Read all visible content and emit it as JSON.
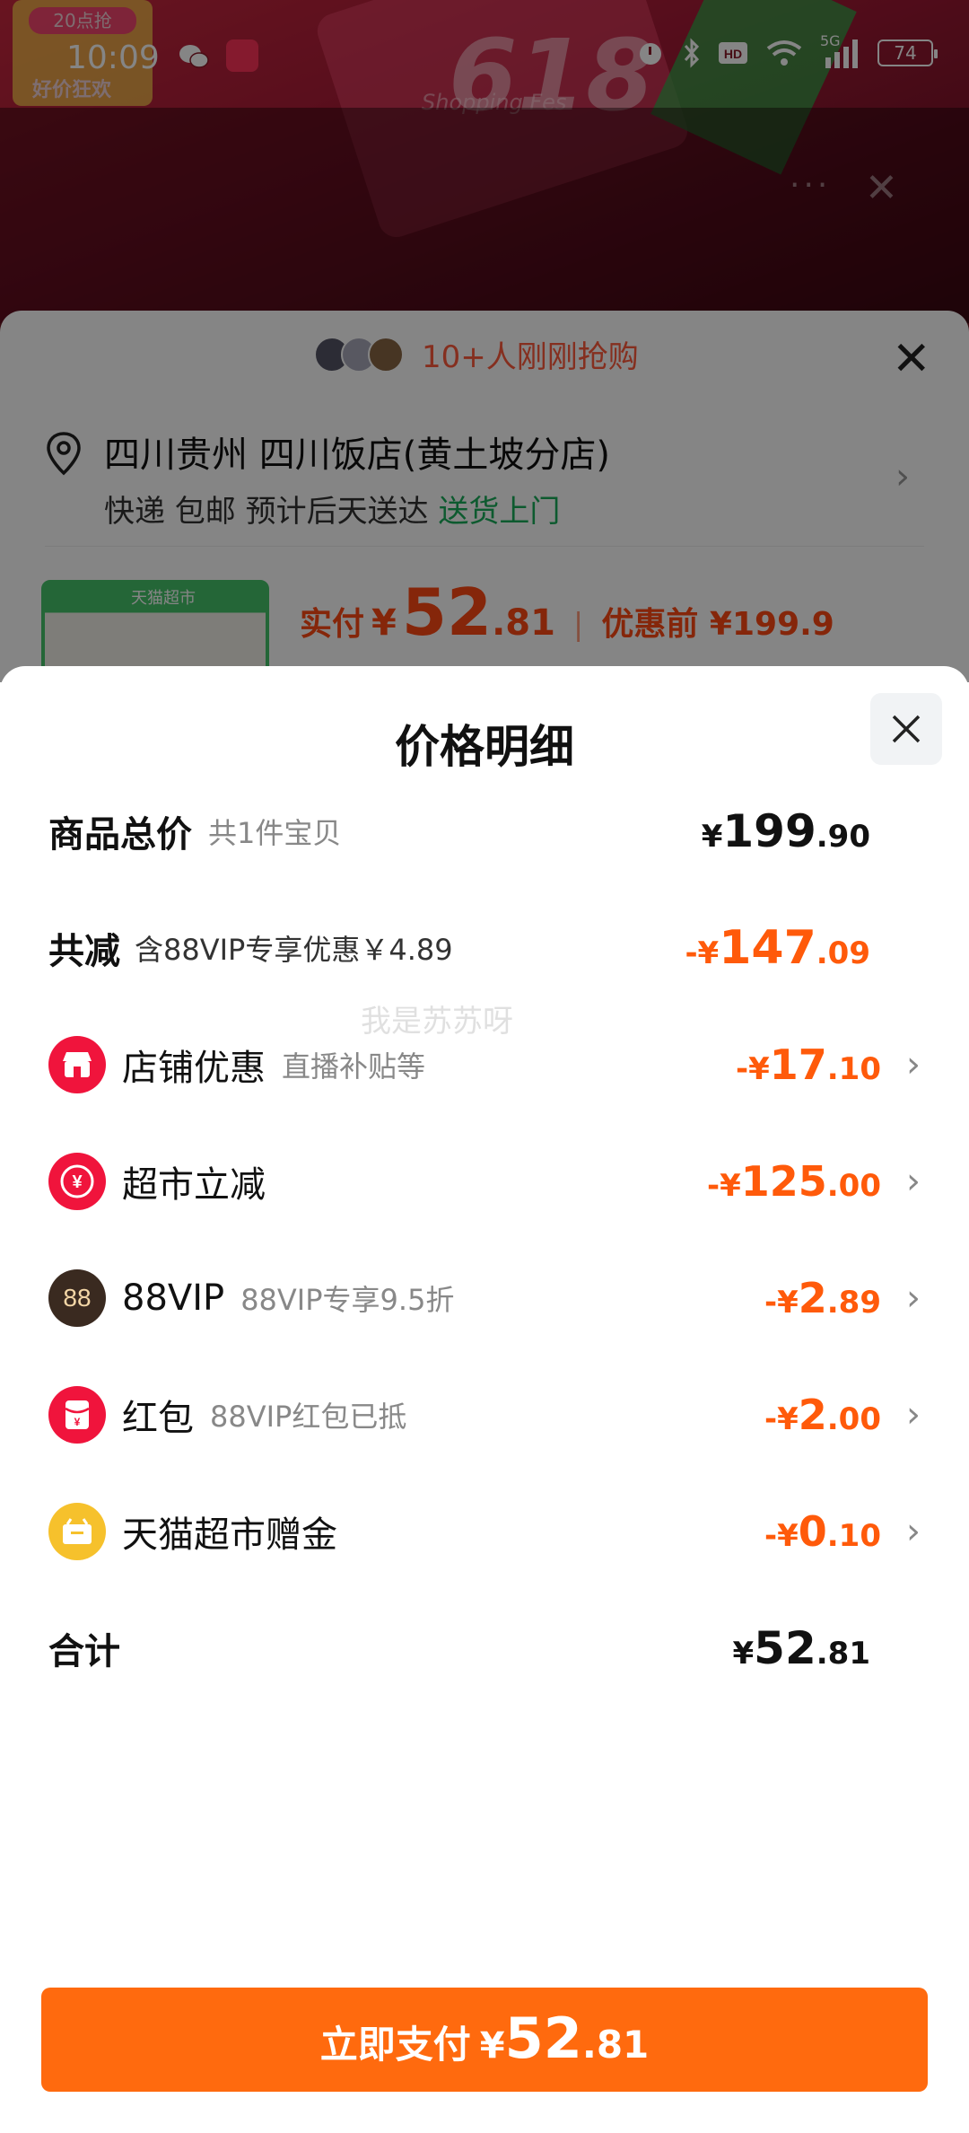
{
  "status_bar": {
    "time": "10:09",
    "battery": "74",
    "network": "5G"
  },
  "background": {
    "promo_text": "618",
    "promo_sub": "Shopping Fes",
    "badge_top": "20点抢",
    "badge_bottom": "好价狂欢",
    "more": "···",
    "close": "✕"
  },
  "order": {
    "buyers_text": "10+人刚刚抢购",
    "address": "四川贵州 四川饭店(黄土坡分店)",
    "delivery_prefix": "快递 包邮 预计后天送达",
    "delivery_highlight": "送货上门",
    "thumb_title": "天猫超市",
    "paid_label": "实付",
    "currency": "¥",
    "paid_int": "52",
    "paid_dec": ".81",
    "before_label": "优惠前 ¥199.9"
  },
  "sheet": {
    "title": "价格明细",
    "total_goods": {
      "label": "商品总价",
      "sub": "共1件宝贝",
      "sym": "¥",
      "int": "199",
      "dec": ".90"
    },
    "total_reduce": {
      "label": "共减",
      "sub": "含88VIP专享优惠￥4.89",
      "sym": "-¥",
      "int": "147",
      "dec": ".09"
    },
    "items": [
      {
        "label": "店铺优惠",
        "sub": "直播补贴等",
        "sym": "-¥",
        "int": "17",
        "dec": ".10",
        "icon": "store-icon",
        "color": "#f0143c"
      },
      {
        "label": "超市立减",
        "sub": "",
        "sym": "-¥",
        "int": "125",
        "dec": ".00",
        "icon": "yuan-coin-icon",
        "color": "#f0143c"
      },
      {
        "label": "88VIP",
        "sub": "88VIP专享9.5折",
        "sym": "-¥",
        "int": "2",
        "dec": ".89",
        "icon": "vip88-icon",
        "color": "#3a2a20",
        "icon_text": "88"
      },
      {
        "label": "红包",
        "sub": "88VIP红包已抵",
        "sym": "-¥",
        "int": "2",
        "dec": ".00",
        "icon": "red-packet-icon",
        "color": "#f0143c"
      },
      {
        "label": "天猫超市赠金",
        "sub": "",
        "sym": "-¥",
        "int": "0",
        "dec": ".10",
        "icon": "gift-money-icon",
        "color": "#f6c12c"
      }
    ],
    "sum": {
      "label": "合计",
      "sym": "¥",
      "int": "52",
      "dec": ".81"
    },
    "watermark": "我是苏苏呀",
    "pay_button": {
      "label": "立即支付",
      "sym": "¥",
      "int": "52",
      "dec": ".81"
    }
  },
  "colors": {
    "accent": "#ff6a0e",
    "discount": "#ff5a0a",
    "green": "#1aad5a"
  }
}
